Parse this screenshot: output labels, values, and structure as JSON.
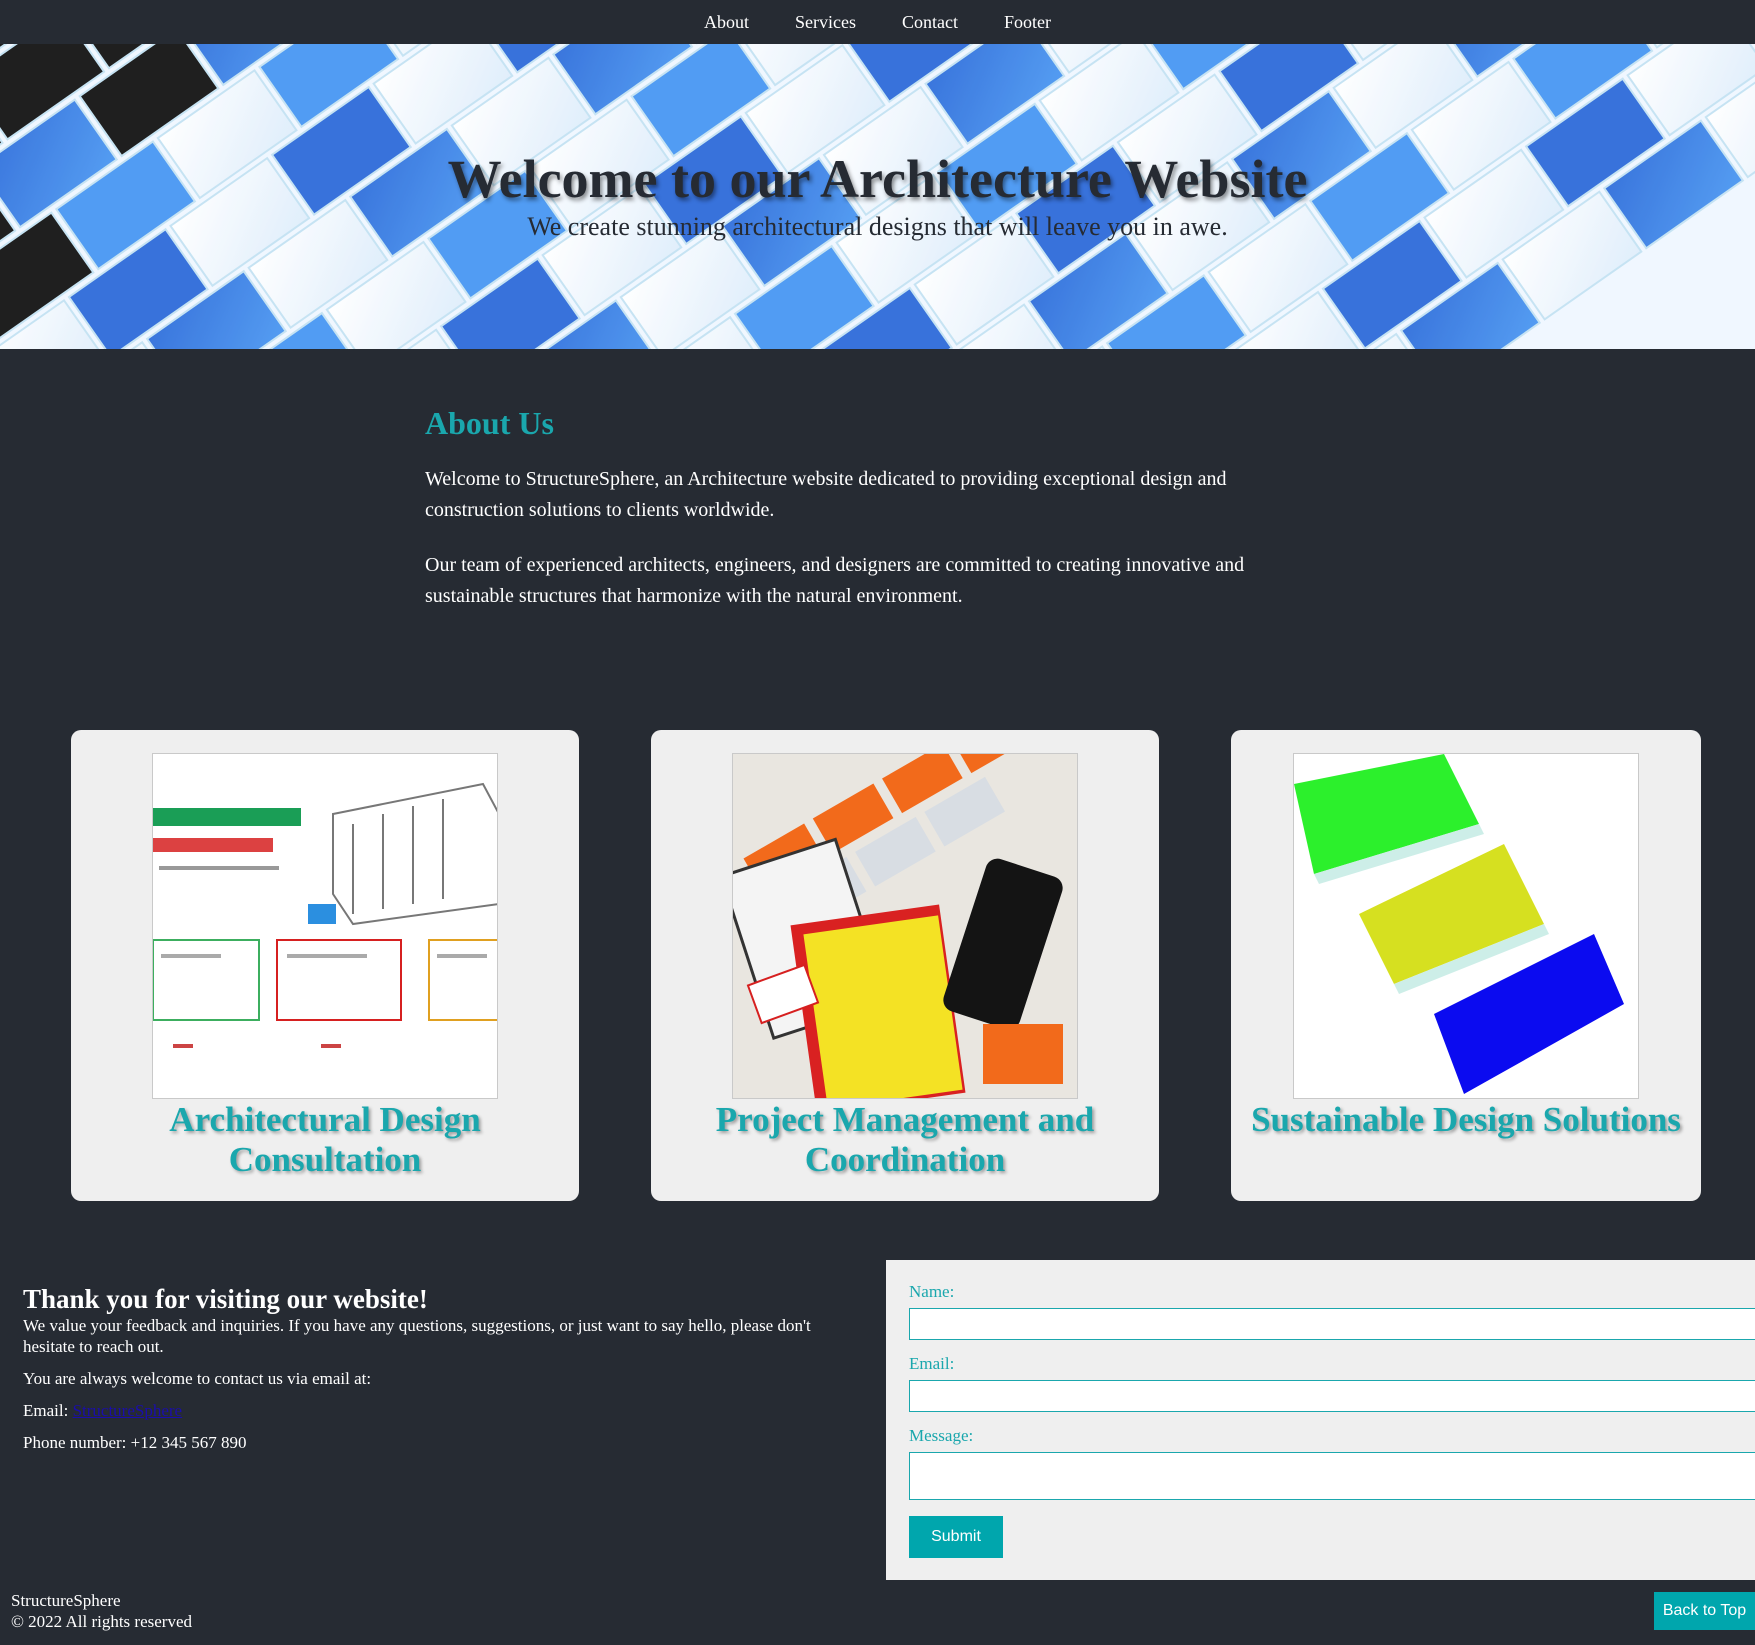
{
  "nav": {
    "items": [
      {
        "label": "About"
      },
      {
        "label": "Services"
      },
      {
        "label": "Contact"
      },
      {
        "label": "Footer"
      }
    ]
  },
  "hero": {
    "title": "Welcome to our Architecture Website",
    "subtitle": "We create stunning architectural designs that will leave you in awe."
  },
  "about": {
    "heading": "About Us",
    "paragraphs": [
      "Welcome to StructureSphere, an Architecture website dedicated to providing exceptional design and construction solutions to clients worldwide.",
      "Our team of experienced architects, engineers, and designers are committed to creating innovative and sustainable structures that harmonize with the natural environment."
    ]
  },
  "services": [
    {
      "title": "Architectural Design Consultation"
    },
    {
      "title": "Project Management and Coordination"
    },
    {
      "title": "Sustainable Design Solutions"
    }
  ],
  "contact": {
    "heading": "Thank you for visiting our website!",
    "intro": "We value your feedback and inquiries. If you have any questions, suggestions, or just want to say hello, please don't hesitate to reach out.",
    "welcome": "You are always welcome to contact us via email at:",
    "email_label": "Email:",
    "email_link": "StructureSphere",
    "phone": "Phone number: +12 345 567 890"
  },
  "form": {
    "name_label": "Name:",
    "email_label": "Email:",
    "message_label": "Message:",
    "name_value": "",
    "email_value": "",
    "message_value": "",
    "submit_label": "Submit"
  },
  "footer": {
    "brand": "StructureSphere",
    "copyright": "© 2022 All rights reserved",
    "back_to_top": "Back to Top"
  },
  "colors": {
    "background": "#262b33",
    "accent": "#1aa7ad",
    "button": "#00a6ad",
    "card": "#efefef"
  }
}
